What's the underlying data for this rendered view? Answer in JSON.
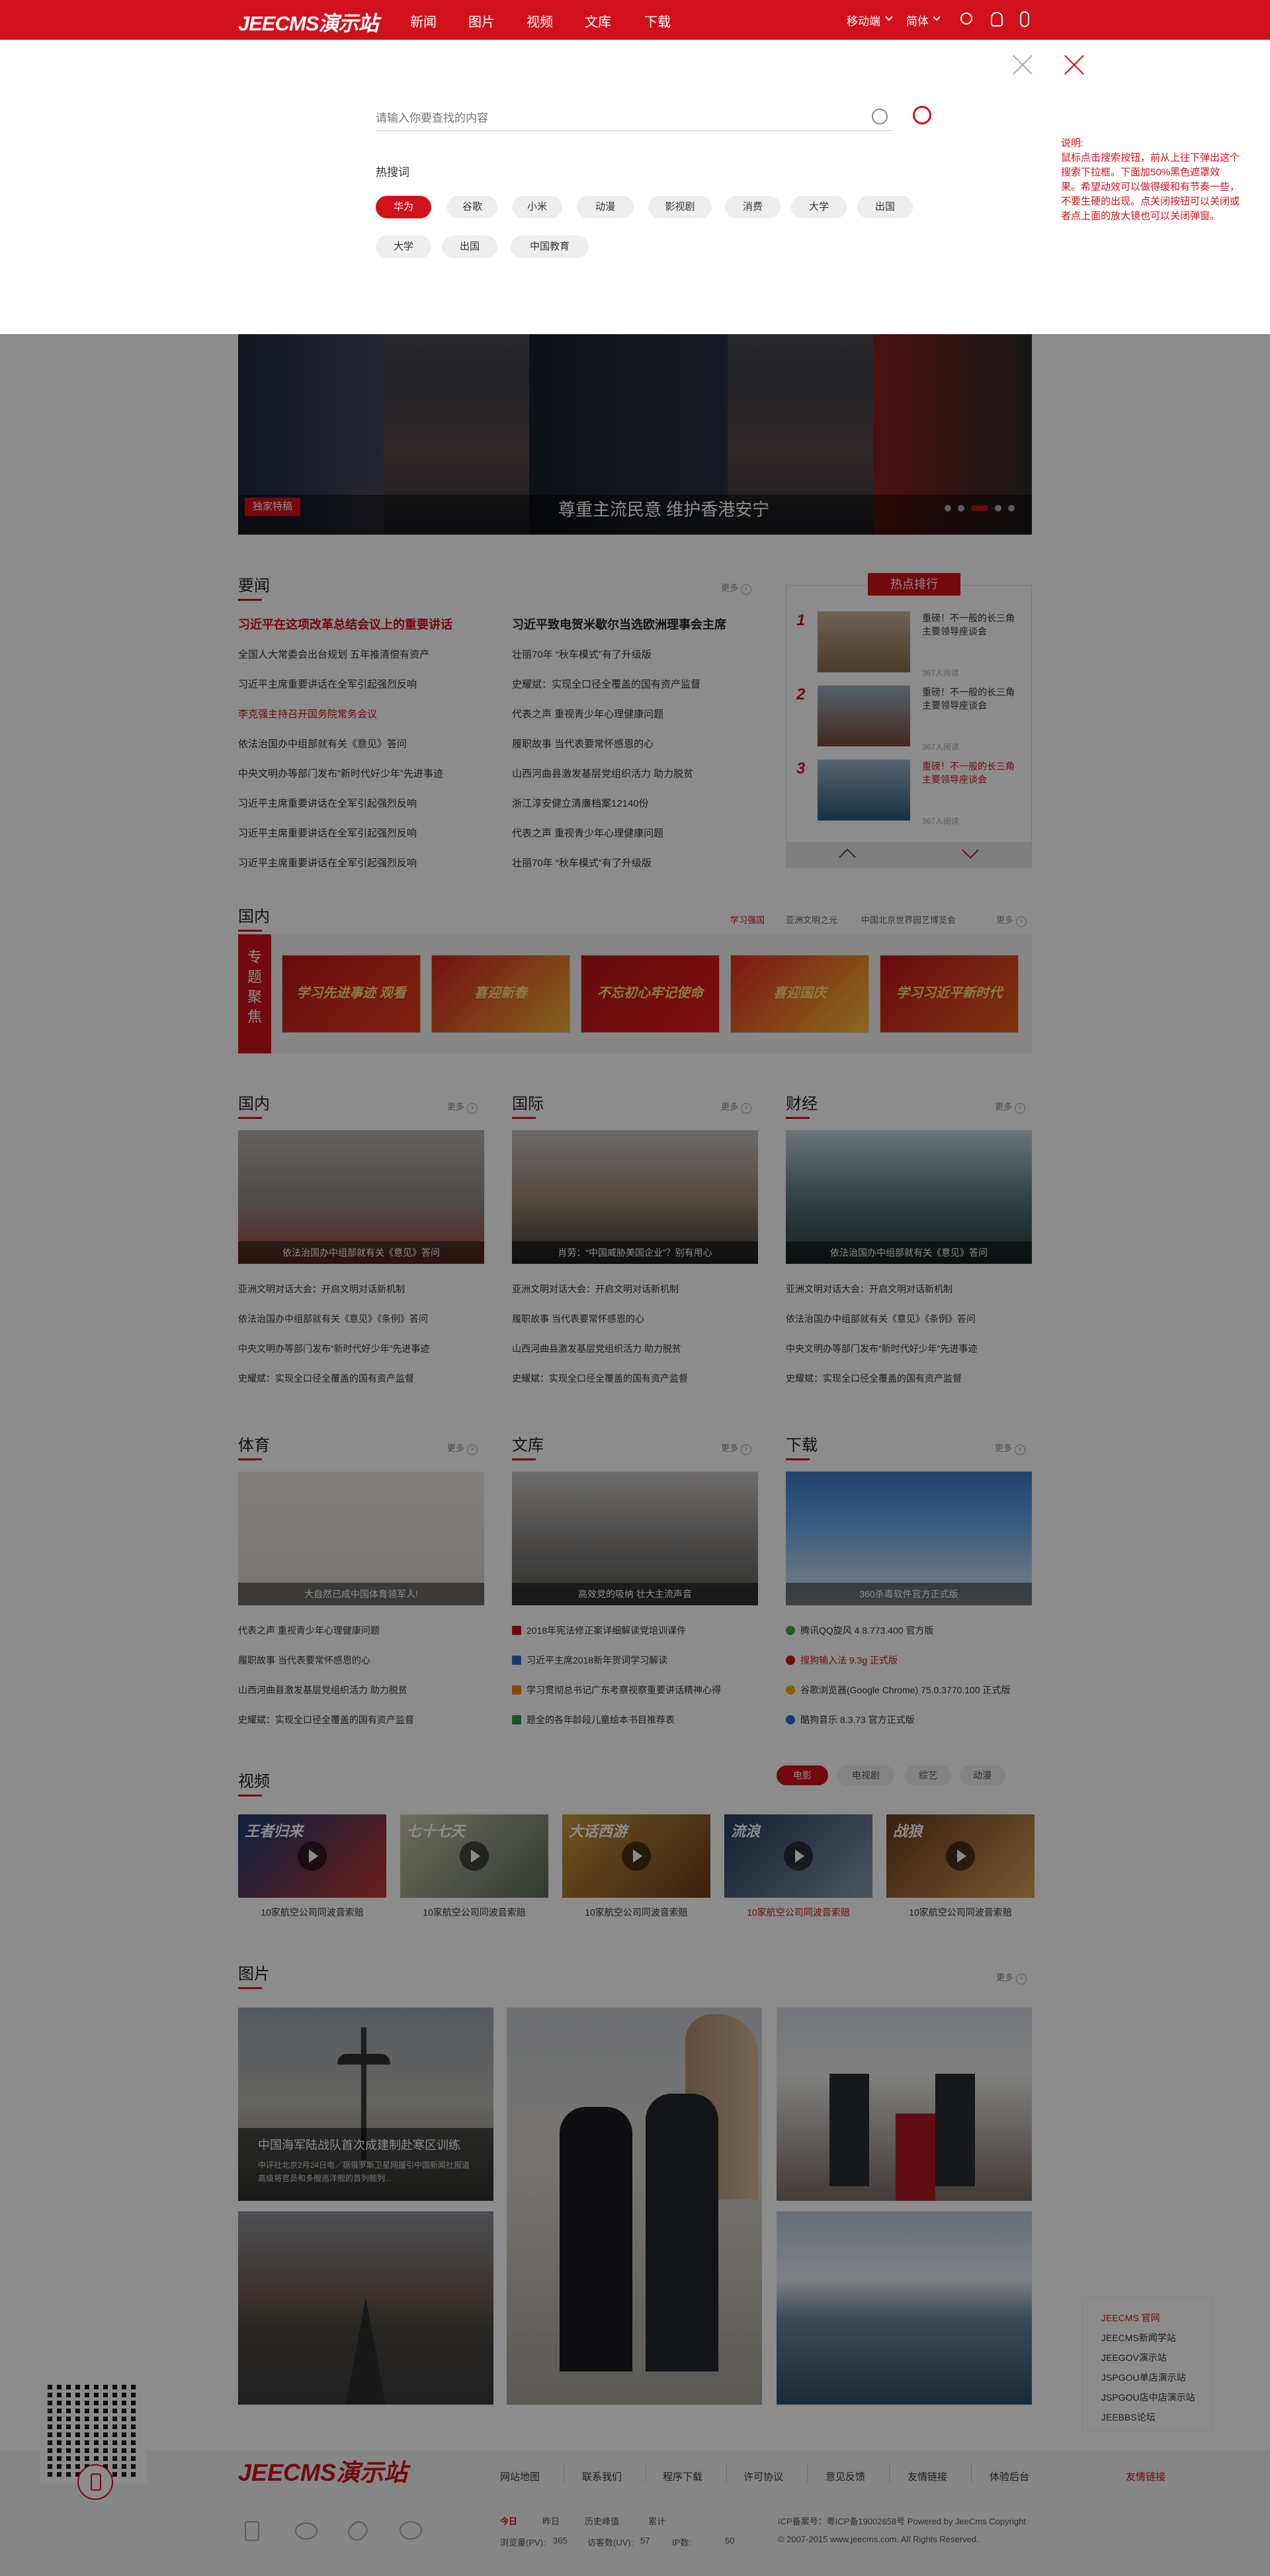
{
  "header": {
    "logo": "JEECMS演示站",
    "nav": [
      "新闻",
      "图片",
      "视频",
      "文库",
      "下载"
    ],
    "mobile": "移动端",
    "lang": "简体"
  },
  "search": {
    "placeholder": "请输入你要查找的内容",
    "hot_title": "热搜词",
    "tags": [
      "华为",
      "谷歌",
      "小米",
      "动漫",
      "影视剧",
      "消费",
      "大学",
      "出国",
      "大学",
      "出国",
      "中国教育"
    ],
    "note": "说明:\n鼠标点击搜索按钮，前从上往下弹出这个搜索下拉框。下面加50%黑色遮罩效果。希望动效可以做得缓和有节奏一些，不要生硬的出现。点关闭按钮可以关闭或者点上面的放大镜也可以关闭弹窗。"
  },
  "banner": {
    "badge": "独家特稿",
    "title": "尊重主流民意 维护香港安宁"
  },
  "yaowen": {
    "title": "要闻",
    "more": "更多",
    "lead_left": "习近平在这项改革总结会议上的重要讲话",
    "lead_right": "习近平致电贺米歇尔当选欧洲理事会主席",
    "left": [
      "全国人大常委会出台规划 五年推清偿有资产",
      "习近平主席重要讲话在全军引起强烈反响",
      "李克强主持召开国务院常务会议",
      "依法治国办中组部就有关《意见》答问",
      "中央文明办等部门发布“新时代好少年”先进事迹",
      "习近平主席重要讲话在全军引起强烈反响",
      "习近平主席重要讲话在全军引起强烈反响",
      "习近平主席重要讲话在全军引起强烈反响"
    ],
    "right": [
      "壮丽70年 “秋车模式”有了升级版",
      "史耀斌：实现全口径全覆盖的国有资产监督",
      "代表之声 重视青少年心理健康问题",
      "履职故事 当代表要常怀感恩的心",
      "山西河曲县激发基层党组织活力 助力脱贫",
      "浙江淳安健立清廉档案12140份",
      "代表之声 重视青少年心理健康问题",
      "壮丽70年 “秋车模式”有了升级版"
    ]
  },
  "rank": {
    "title": "热点排行",
    "items": [
      {
        "num": "1",
        "text": "重磅！不一般的长三角主要领导座谈会",
        "count": "367人阅读"
      },
      {
        "num": "2",
        "text": "重磅！不一般的长三角主要领导座谈会",
        "count": "367人阅读"
      },
      {
        "num": "3",
        "text": "重磅！不一般的长三角主要领导座谈会",
        "count": "367人阅读"
      }
    ]
  },
  "guonei_top": {
    "title": "国内",
    "tabs": [
      "学习强国",
      "亚洲文明之光",
      "中国北京世界园艺博览会"
    ],
    "more": "更多",
    "topic_label": "专题聚焦",
    "banners": [
      "学习先进事迹 观看",
      "喜迎新春",
      "不忘初心牢记使命",
      "喜迎国庆",
      "学习习近平新时代"
    ]
  },
  "three1": [
    {
      "title": "国内",
      "more": "更多",
      "caption": "依法治国办中组部就有关《意见》答问",
      "items": [
        "亚洲文明对话大会：开启文明对话新机制",
        "依法治国办中组部就有关《意见》《条例》答问",
        "中央文明办等部门发布“新时代好少年”先进事迹",
        "史耀斌：实现全口径全覆盖的国有资产监督"
      ]
    },
    {
      "title": "国际",
      "more": "更多",
      "caption": "肖劳：“中国威胁美国企业”？别有用心",
      "items": [
        "亚洲文明对话大会：开启文明对话新机制",
        "履职故事 当代表要常怀感恩的心",
        "山西河曲县激发基层党组织活力 助力脱贫",
        "史耀斌：实现全口径全覆盖的国有资产监督"
      ]
    },
    {
      "title": "财经",
      "more": "更多",
      "caption": "依法治国办中组部就有关《意见》答问",
      "items": [
        "亚洲文明对话大会：开启文明对话新机制",
        "依法治国办中组部就有关《意见》《条例》答问",
        "中央文明办等部门发布“新时代好少年”先进事迹",
        "史耀斌：实现全口径全覆盖的国有资产监督"
      ]
    }
  ],
  "three2": [
    {
      "title": "体育",
      "more": "更多",
      "caption": "大自然已成中国体育领军人!",
      "items": [
        "代表之声 重视青少年心理健康问题",
        "履职故事 当代表要常怀感恩的心",
        "山西河曲县激发基层党组织活力 助力脱贫",
        "史耀斌：实现全口径全覆盖的国有资产监督"
      ]
    },
    {
      "title": "文库",
      "more": "更多",
      "caption": "高效党的吸纳 壮大主流声音",
      "items": [
        "2018年宪法修正案详细解读党培训课件",
        "习近平主席2018新年贺词学习解读",
        "学习贯彻总书记广东考察视察重要讲话精神心得",
        "题全的各年龄段儿童绘本书目推荐表"
      ]
    },
    {
      "title": "下载",
      "more": "更多",
      "caption": "360杀毒软件官方正式版",
      "items": [
        "腾讯QQ旋风 4.8.773.400 官方版",
        "搜狗输入法 9.3g 正式版",
        "谷歌浏览器(Google Chrome) 75.0.3770.100 正式版",
        "酷狗音乐 8.3.73 官方正式版"
      ]
    }
  ],
  "video": {
    "title": "视频",
    "tabs": [
      "电影",
      "电视剧",
      "综艺",
      "动漫"
    ],
    "items": [
      "10家航空公司同波音索赔",
      "10家航空公司同波音索赔",
      "10家航空公司同波音索赔",
      "10家航空公司同波音索赔",
      "10家航空公司同波音索赔"
    ],
    "thumb_texts": [
      "王者归来",
      "七十七天",
      "大话西游",
      "流浪",
      "战狼"
    ]
  },
  "pics": {
    "title": "图片",
    "more": "更多",
    "caption_title": "中国海军陆战队首次成建制赴寒区训练",
    "caption_text": "中评社北京2月24日电／据俄罗斯卫星网援引中国新闻社报道高级将官员和多艘巡洋舰的首列舰列..."
  },
  "friends": {
    "title": "JEECMS 官网",
    "items": [
      "JEECMS新闻学站",
      "JEEGOV演示站",
      "JSPGOU单店演示站",
      "JSPGOU店中店演示站",
      "JEEBBS论坛"
    ]
  },
  "footer": {
    "logo": "JEECMS演示站",
    "links": [
      "网站地图",
      "联系我们",
      "程序下载",
      "许可协议",
      "意见反馈",
      "友情链接",
      "体验后台"
    ],
    "friend_link": "友情链接",
    "stat_tabs": [
      "今日",
      "昨日",
      "历史峰值",
      "累计"
    ],
    "stats": [
      {
        "label": "浏览量(PV):",
        "value": "365"
      },
      {
        "label": "访客数(UV):",
        "value": "57"
      },
      {
        "label": "IP数:",
        "value": "50"
      }
    ],
    "icp": "ICP备案号：粤ICP备19002658号 Powered by JeeCms Copyright",
    "copy": "© 2007-2015 www.jeecms.com. All Rights Reserved."
  }
}
